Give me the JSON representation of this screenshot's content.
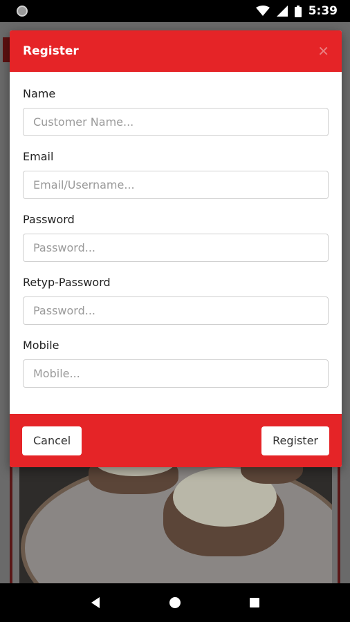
{
  "status_bar": {
    "time": "5:39",
    "icons": [
      "notification-dot-icon",
      "wifi-icon",
      "cell-signal-icon",
      "battery-icon"
    ]
  },
  "modal": {
    "title": "Register",
    "close_icon": "close-icon",
    "fields": [
      {
        "label": "Name",
        "placeholder": "Customer Name...",
        "value": ""
      },
      {
        "label": "Email",
        "placeholder": "Email/Username...",
        "value": ""
      },
      {
        "label": "Password",
        "placeholder": "Password...",
        "value": ""
      },
      {
        "label": "Retyp-Password",
        "placeholder": "Password...",
        "value": ""
      },
      {
        "label": "Mobile",
        "placeholder": "Mobile...",
        "value": ""
      }
    ],
    "cancel_label": "Cancel",
    "register_label": "Register"
  },
  "nav_bar": {
    "icons": [
      "back-icon",
      "home-icon",
      "recents-icon"
    ]
  },
  "colors": {
    "accent": "#e52427",
    "overlay": "#5e5e5e"
  }
}
